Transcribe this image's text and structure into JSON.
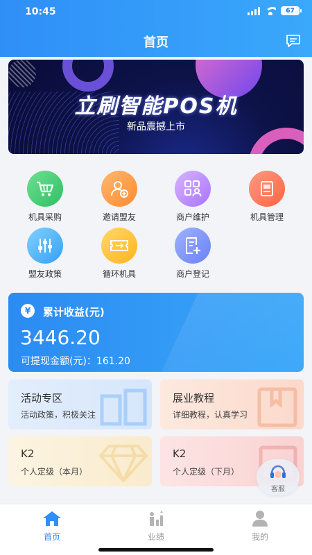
{
  "status_bar": {
    "time": "10:45",
    "battery": "67"
  },
  "header": {
    "title": "首页",
    "message_icon": "message-icon"
  },
  "banner": {
    "headline": "立刷智能POS机",
    "subtitle": "新品震撼上市"
  },
  "menu": [
    {
      "label": "机具采购",
      "icon": "cart-icon",
      "color": "#3cc872"
    },
    {
      "label": "邀请盟友",
      "icon": "add-user-icon",
      "color": "#ff9a40"
    },
    {
      "label": "商户维护",
      "icon": "merchant-icon",
      "color": "#b888ff"
    },
    {
      "label": "机具管理",
      "icon": "pos-device-icon",
      "color": "#ff7555"
    },
    {
      "label": "盟友政策",
      "icon": "sliders-icon",
      "color": "#45aef7"
    },
    {
      "label": "循环机具",
      "icon": "ticket-icon",
      "color": "#ffc12e"
    },
    {
      "label": "商户登记",
      "icon": "register-icon",
      "color": "#7a8ef7"
    }
  ],
  "earnings": {
    "label": "累计收益(元)",
    "amount": "3446.20",
    "withdrawable": "可提现金额(元)：161.20"
  },
  "cards": [
    {
      "title": "活动专区",
      "subtitle": "活动政策，积极关注"
    },
    {
      "title": "展业教程",
      "subtitle": "详细教程，认真学习"
    },
    {
      "title": "K2",
      "subtitle": "个人定级（本月）"
    },
    {
      "title": "K2",
      "subtitle": "个人定级（下月）"
    }
  ],
  "service_button": {
    "label": "客服"
  },
  "tabbar": [
    {
      "label": "首页",
      "icon": "home-icon",
      "active": true
    },
    {
      "label": "业绩",
      "icon": "performance-icon",
      "active": false
    },
    {
      "label": "我的",
      "icon": "user-icon",
      "active": false
    }
  ]
}
